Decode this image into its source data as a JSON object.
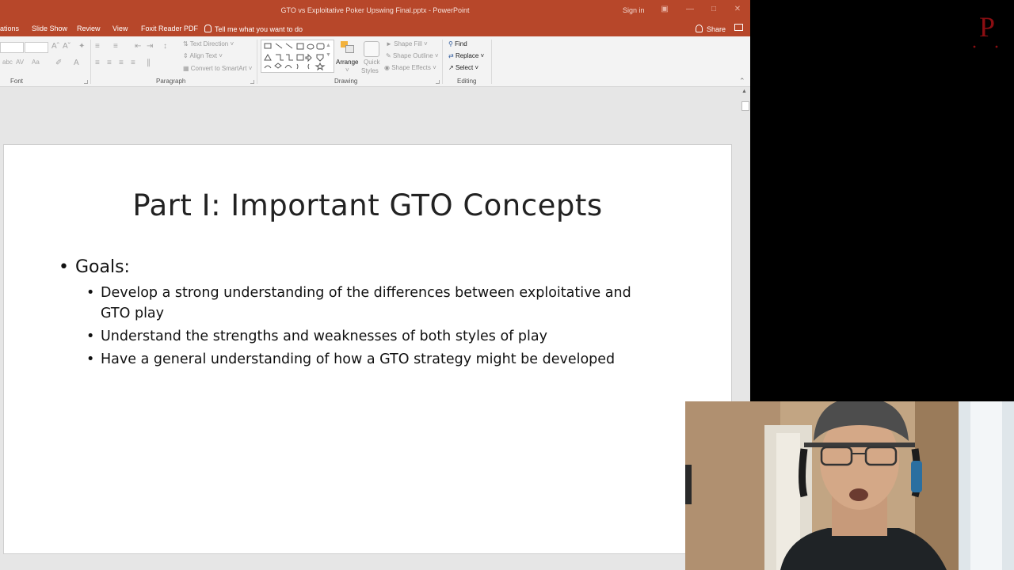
{
  "window": {
    "title": "GTO vs Exploitative Poker Upswing Final.pptx - PowerPoint",
    "sign_in": "Sign in",
    "brand_color": "#b7472a"
  },
  "tabs": [
    "ations",
    "Slide Show",
    "Review",
    "View",
    "Foxit Reader PDF"
  ],
  "tell_me": "Tell me what you want to do",
  "share": "Share",
  "ribbon": {
    "groups": {
      "font": "Font",
      "paragraph": "Paragraph",
      "drawing": "Drawing",
      "editing": "Editing"
    },
    "paragraph": {
      "text_direction": "Text Direction",
      "align_text": "Align Text",
      "convert_smartart": "Convert to SmartArt"
    },
    "drawing": {
      "arrange": "Arrange",
      "quick_styles_1": "Quick",
      "quick_styles_2": "Styles",
      "shape_fill": "Shape Fill",
      "shape_outline": "Shape Outline",
      "shape_effects": "Shape Effects"
    },
    "editing": {
      "find": "Find",
      "replace": "Replace",
      "select": "Select"
    }
  },
  "slide": {
    "title": "Part I: Important GTO Concepts",
    "bullet": "Goals:",
    "sub_bullets": [
      "Develop a strong understanding of the differences between exploitative and GTO play",
      "Understand the strengths and weaknesses of both styles of play",
      "Have a general understanding of how a GTO strategy might be developed"
    ]
  },
  "logo_letter": "P"
}
